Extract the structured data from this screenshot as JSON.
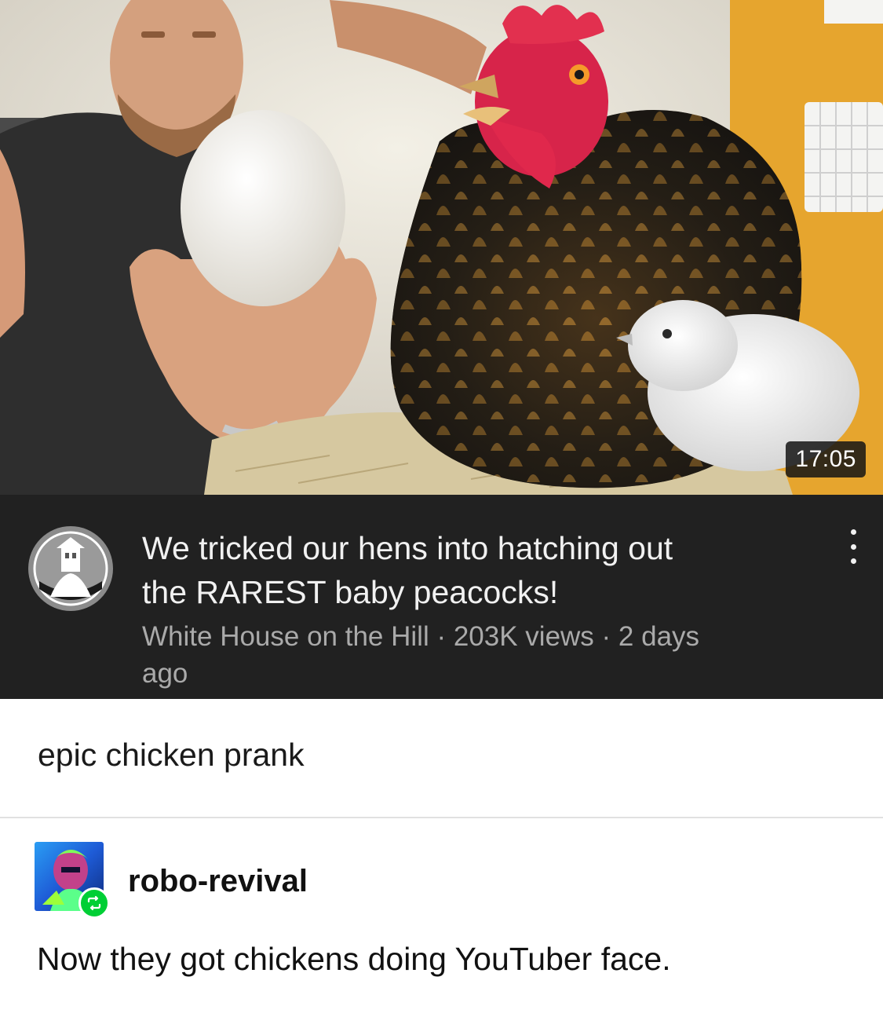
{
  "video": {
    "duration": "17:05",
    "title_line1": "We tricked our hens into hatching out",
    "title_line2": "the RAREST baby peacocks!",
    "meta_line1": "White House on the Hill · 203K views · 2 days",
    "meta_line2": "ago",
    "colors": {
      "card_background": "#212121",
      "title": "#f1f1f1",
      "meta": "#aaaaaa"
    }
  },
  "post": {
    "caption": "epic chicken prank",
    "reblogger": {
      "username": "robo-revival",
      "badge_icon": "reblog-icon",
      "badge_color": "#00cf35"
    },
    "reblog_text": "Now they got chickens doing YouTuber face."
  },
  "icons": {
    "more": "more-vertical-icon",
    "channel": "channel-avatar-icon"
  }
}
